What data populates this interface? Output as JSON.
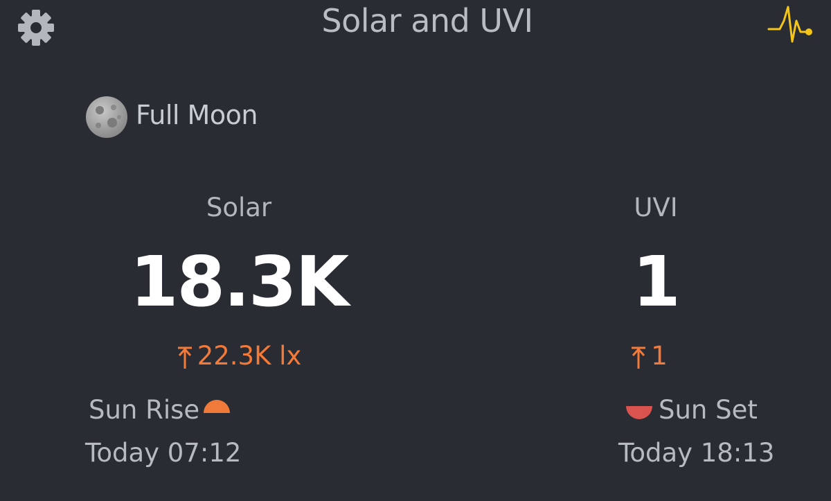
{
  "header": {
    "title": "Solar and UVI",
    "settings_icon": "gear-icon",
    "activity_icon": "pulse-chart-icon",
    "accent_color": "#f5c518"
  },
  "moon": {
    "icon": "full-moon-icon",
    "phase": "Full Moon"
  },
  "solar": {
    "label": "Solar",
    "value": "18.3K",
    "max_icon": "max-arrow-icon",
    "max": "22.3K lx"
  },
  "uvi": {
    "label": "UVI",
    "value": "1",
    "max_icon": "max-arrow-icon",
    "max": "1"
  },
  "sunrise": {
    "label": "Sun Rise",
    "icon": "sunrise-icon",
    "time": "Today 07:12",
    "color": "#f07a3a"
  },
  "sunset": {
    "label": "Sun Set",
    "icon": "sunset-icon",
    "time": "Today 18:13",
    "color": "#d9534f"
  },
  "colors": {
    "background": "#2a2c33",
    "highlight": "#f47a3a"
  }
}
